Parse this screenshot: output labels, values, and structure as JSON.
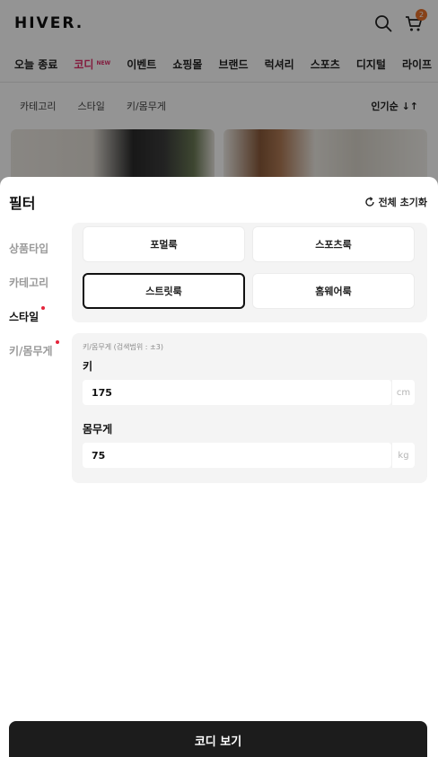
{
  "app": {
    "logo": "HIVER.",
    "cart_count": "2"
  },
  "nav": {
    "items": [
      {
        "label": "오늘 종료"
      },
      {
        "label": "코디",
        "badge": "NEW",
        "active": true
      },
      {
        "label": "이벤트"
      },
      {
        "label": "쇼핑몰"
      },
      {
        "label": "브랜드"
      },
      {
        "label": "럭셔리"
      },
      {
        "label": "스포츠"
      },
      {
        "label": "디지털"
      },
      {
        "label": "라이프"
      }
    ]
  },
  "subnav": {
    "items": [
      "카테고리",
      "스타일",
      "키/몸무게"
    ],
    "sort_label": "인기순 ↓↑"
  },
  "filter": {
    "title": "필터",
    "reset_label": "전체 초기화",
    "sidebar": [
      {
        "label": "상품타입",
        "active": false,
        "dot": false
      },
      {
        "label": "카테고리",
        "active": false,
        "dot": false
      },
      {
        "label": "스타일",
        "active": true,
        "dot": true
      },
      {
        "label": "키/몸무게",
        "active": false,
        "dot": true
      }
    ],
    "styles": [
      {
        "label": "포멀룩",
        "selected": false
      },
      {
        "label": "스포츠룩",
        "selected": false
      },
      {
        "label": "스트릿룩",
        "selected": true
      },
      {
        "label": "홈웨어룩",
        "selected": false
      }
    ],
    "body": {
      "note": "키/몸무게 (검색범위 : ±3)",
      "height_label": "키",
      "height_value": "175",
      "height_unit": "cm",
      "weight_label": "몸무게",
      "weight_value": "75",
      "weight_unit": "kg"
    }
  },
  "cta": {
    "label": "코디 보기"
  },
  "colors": {
    "accent": "#e0306a",
    "dot": "#e5243b",
    "badge": "#e8732c",
    "cta_bg": "#1c1c1c"
  }
}
